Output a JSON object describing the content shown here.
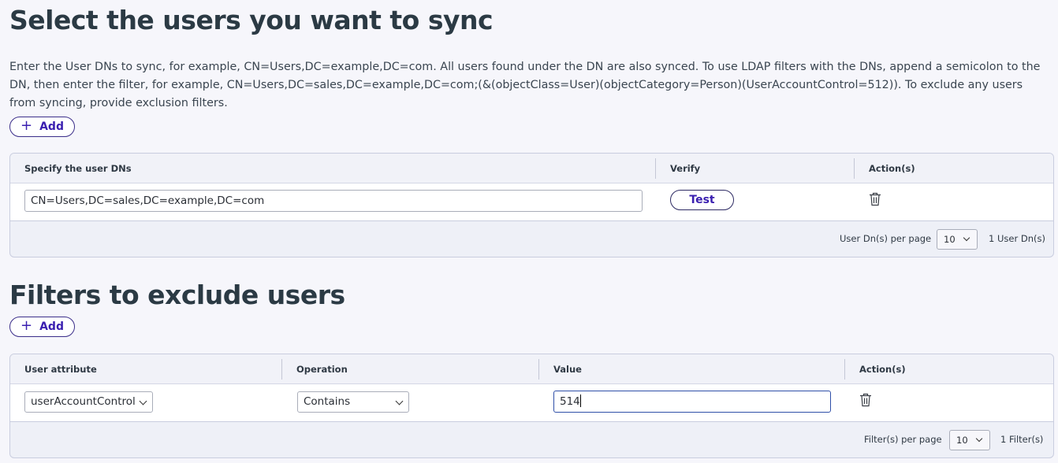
{
  "sync_section": {
    "title": "Select the users you want to sync",
    "description": "Enter the User DNs to sync, for example, CN=Users,DC=example,DC=com. All users found under the DN are also synced. To use LDAP filters with the DNs, append a semicolon to the DN, then enter the filter, for example, CN=Users,DC=sales,DC=example,DC=com;(&(objectClass=User)(objectCategory=Person)(UserAccountControl=512)). To exclude any users from syncing, provide exclusion filters.",
    "add_label": "Add",
    "table": {
      "headers": [
        "Specify the user DNs",
        "Verify",
        "Action(s)"
      ],
      "row": {
        "dn_value": "CN=Users,DC=sales,DC=example,DC=com",
        "test_label": "Test"
      },
      "footer": {
        "per_page_label": "User Dn(s) per page",
        "per_page_value": "10",
        "count_label": "1 User Dn(s)"
      }
    }
  },
  "filter_section": {
    "title": "Filters to exclude users",
    "add_label": "Add",
    "table": {
      "headers": [
        "User attribute",
        "Operation",
        "Value",
        "Action(s)"
      ],
      "row": {
        "attribute": "userAccountControl",
        "operation": "Contains",
        "value": "514"
      },
      "footer": {
        "per_page_label": "Filter(s) per page",
        "per_page_value": "10",
        "count_label": "1 Filter(s)"
      }
    }
  },
  "colors": {
    "accent": "#3a1fb0",
    "border": "#c9cddf",
    "background": "#f6f6fb"
  }
}
